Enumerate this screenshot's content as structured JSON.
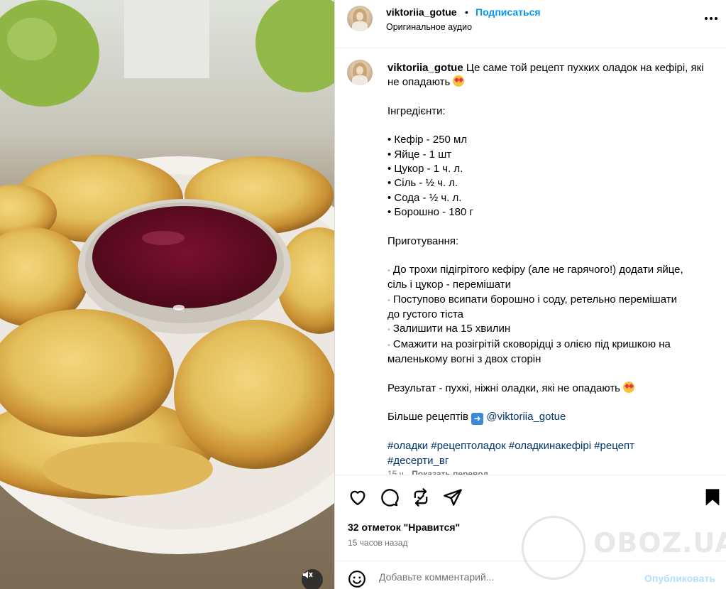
{
  "header": {
    "username": "viktoriia_gotue",
    "dot": "•",
    "follow_label": "Подписаться",
    "audio": "Оригинальное аудио"
  },
  "caption": {
    "username": "viktoriia_gotue",
    "intro": "Це саме той рецепт пухких оладок на кефірі, які не опадають",
    "ingredients_title": "Інгредієнти:",
    "ingredients": [
      "• Кефір - 250 мл",
      "• Яйце - 1 шт",
      "• Цукор - 1 ч. л.",
      "• Сіль - ½ ч. л.",
      "• Сода - ½ ч. л.",
      "• Борошно - 180 г"
    ],
    "method_title": "Приготування:",
    "steps": [
      "До трохи підігрітого кефіру (але не гарячого!) додати яйце,",
      "сіль і цукор - перемішати",
      "Поступово всипати борошно і соду, ретельно перемішати",
      "до густого тіста",
      "Залишити на 15 хвилин",
      "Смажити на розігрітій сковорідці з олією під кришкою на",
      "маленькому вогні з двох сторін"
    ],
    "result": "Результат - пухкі, ніжні оладки, які не опадають",
    "more_prefix": "Більше рецептів",
    "more_link": "@viktoriia_gotue",
    "hashtags_line1": "#оладки #рецептоладок #оладкинакефірі #рецепт",
    "hashtags_line2": "#десерти_вг",
    "time": "15 ч.",
    "translate": "Показать перевод"
  },
  "actions": {
    "likes": "32 отметок \"Нравится\"",
    "posted": "15 часов назад"
  },
  "comment": {
    "placeholder": "Добавьте комментарий...",
    "publish_label": "Опубликовать"
  },
  "watermark": {
    "text": "OBOZ.UA"
  },
  "colors": {
    "accent": "#0095f6",
    "publish_disabled": "#b2dffc",
    "secondary_text": "#737373",
    "link": "#00376b"
  }
}
